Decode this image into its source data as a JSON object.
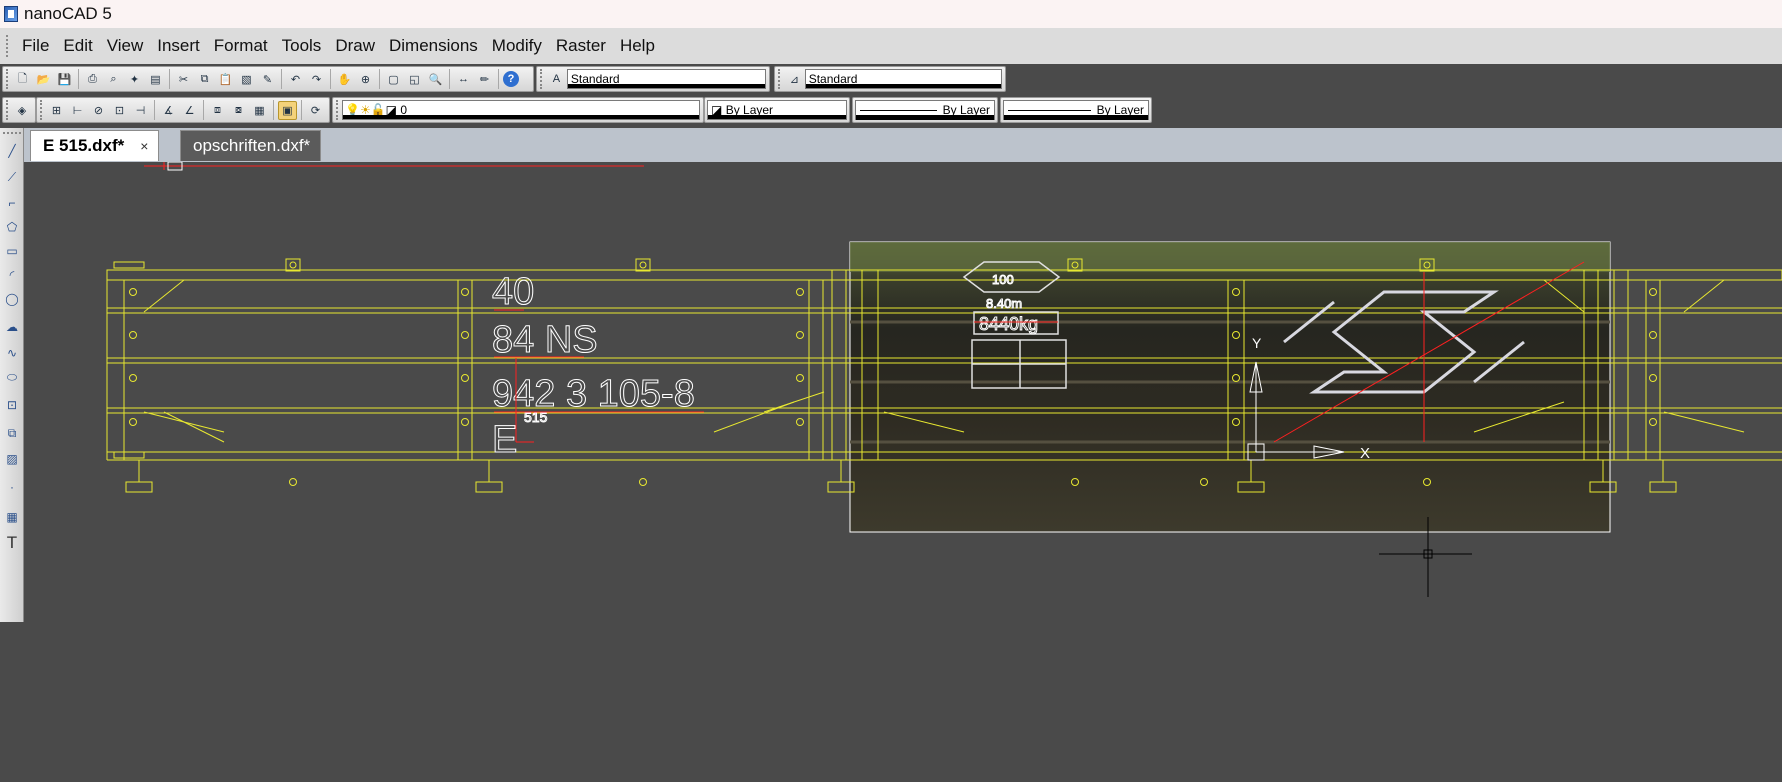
{
  "window": {
    "title": "nanoCAD 5"
  },
  "menu": [
    "File",
    "Edit",
    "View",
    "Insert",
    "Format",
    "Tools",
    "Draw",
    "Dimensions",
    "Modify",
    "Raster",
    "Help"
  ],
  "toolbar1": {
    "text_style": "Standard",
    "dim_style": "Standard"
  },
  "toolbar2": {
    "layer": "0",
    "color": "By Layer",
    "linetype": "By Layer",
    "lineweight": "By Layer"
  },
  "tabs": [
    {
      "label": "E 515.dxf*",
      "active": true,
      "close": "×"
    },
    {
      "label": "opschriften.dxf*",
      "active": false
    }
  ],
  "drawing": {
    "markings": {
      "line1": "40",
      "line2": "84 NS",
      "line3": "942 3 105-8",
      "line4": "E",
      "small": "515",
      "weight": "8440kg",
      "speed": "100",
      "dist": "8.40m"
    },
    "ucs": {
      "y_label": "Y",
      "x_label": "X"
    }
  },
  "colors": {
    "geometry": "#e8e830",
    "annotation": "#ff2020",
    "text_white": "#ffffff",
    "canvas": "#4a4a4a"
  }
}
